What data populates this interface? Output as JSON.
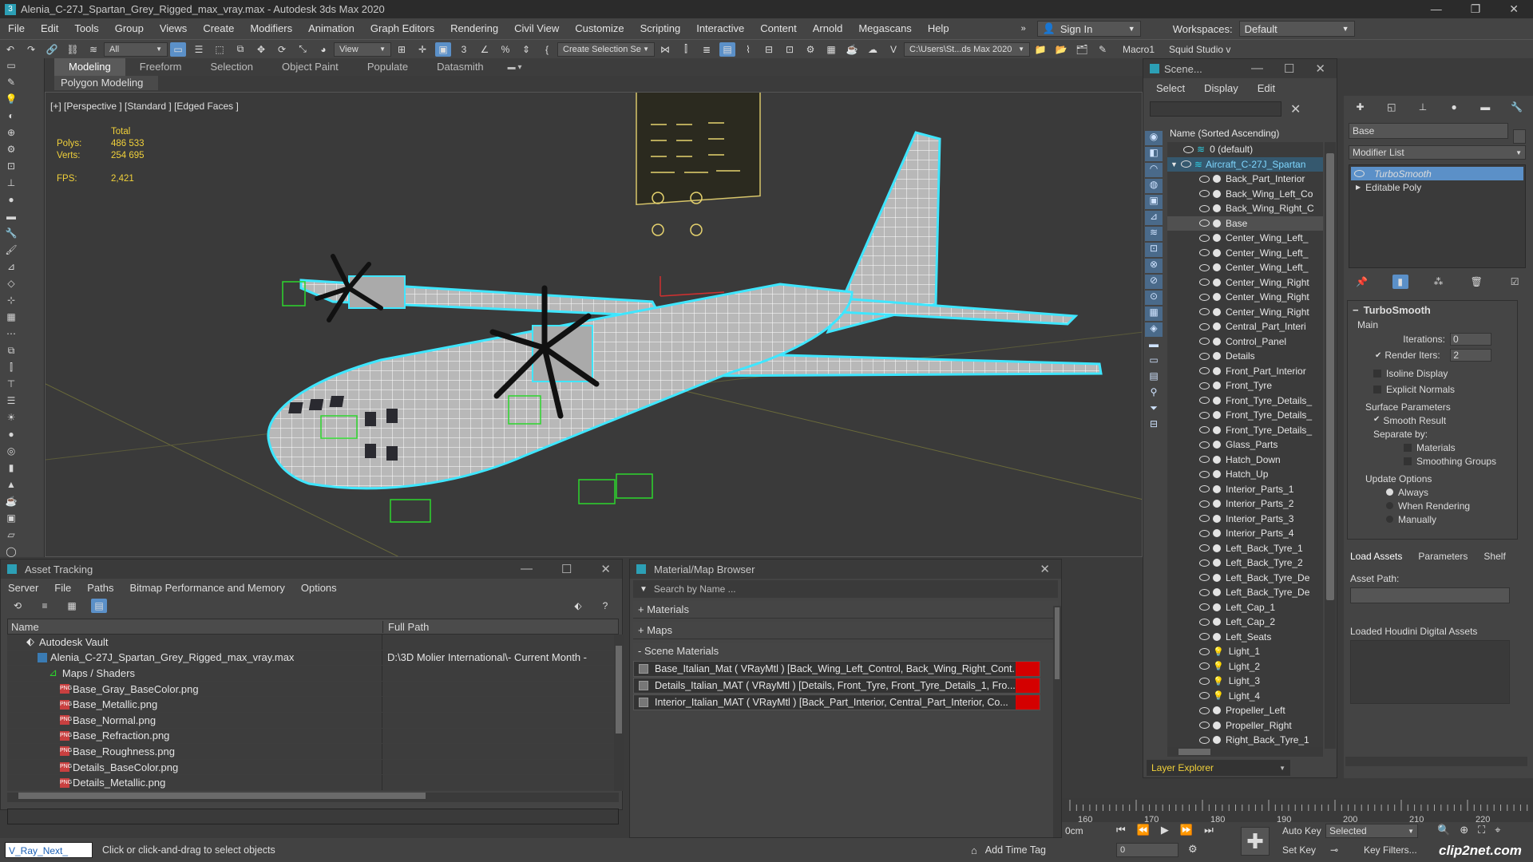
{
  "window": {
    "title": "Alenia_C-27J_Spartan_Grey_Rigged_max_vray.max - Autodesk 3ds Max 2020"
  },
  "menu": [
    "File",
    "Edit",
    "Tools",
    "Group",
    "Views",
    "Create",
    "Modifiers",
    "Animation",
    "Graph Editors",
    "Rendering",
    "Civil View",
    "Customize",
    "Scripting",
    "Interactive",
    "Content",
    "Arnold",
    "Megascans",
    "Help"
  ],
  "signin": "Sign In",
  "workspaces": {
    "label": "Workspaces:",
    "value": "Default"
  },
  "toolbar": {
    "filter": "All",
    "refcoord": "View",
    "selset": "Create Selection Se",
    "path": "C:\\Users\\St...ds Max 2020",
    "macro": "Macro1",
    "squid": "Squid Studio v"
  },
  "ribbon": {
    "tabs": [
      "Modeling",
      "Freeform",
      "Selection",
      "Object Paint",
      "Populate",
      "Datasmith"
    ],
    "sub": "Polygon Modeling"
  },
  "viewport": {
    "label": "[+] [Perspective ] [Standard ] [Edged Faces ]",
    "stats": {
      "total": "Total",
      "polys_label": "Polys:",
      "polys": "486 533",
      "verts_label": "Verts:",
      "verts": "254 695",
      "fps_label": "FPS:",
      "fps": "2,421"
    }
  },
  "scene": {
    "title": "Scene...",
    "menu": [
      "Select",
      "Display",
      "Edit"
    ],
    "header": "Name (Sorted Ascending)",
    "root": "0 (default)",
    "model": "Aircraft_C-27J_Spartan",
    "items": [
      "Back_Part_Interior",
      "Back_Wing_Left_Co",
      "Back_Wing_Right_C",
      "Base",
      "Center_Wing_Left_",
      "Center_Wing_Left_",
      "Center_Wing_Left_",
      "Center_Wing_Right",
      "Center_Wing_Right",
      "Center_Wing_Right",
      "Central_Part_Interi",
      "Control_Panel",
      "Details",
      "Front_Part_Interior",
      "Front_Tyre",
      "Front_Tyre_Details_",
      "Front_Tyre_Details_",
      "Front_Tyre_Details_",
      "Glass_Parts",
      "Hatch_Down",
      "Hatch_Up",
      "Interior_Parts_1",
      "Interior_Parts_2",
      "Interior_Parts_3",
      "Interior_Parts_4",
      "Left_Back_Tyre_1",
      "Left_Back_Tyre_2",
      "Left_Back_Tyre_De",
      "Left_Back_Tyre_De",
      "Left_Cap_1",
      "Left_Cap_2",
      "Left_Seats",
      "Light_1",
      "Light_2",
      "Light_3",
      "Light_4",
      "Propeller_Left",
      "Propeller_Right",
      "Right_Back_Tyre_1"
    ],
    "footer": "Layer Explorer"
  },
  "command": {
    "object_name": "Base",
    "modifier_list": "Modifier List",
    "stack": [
      "TurboSmooth",
      "Editable Poly"
    ],
    "turbosmooth": {
      "title": "TurboSmooth",
      "main": "Main",
      "iterations_label": "Iterations:",
      "iterations": "0",
      "render_iters_label": "Render Iters:",
      "render_iters": "2",
      "isoline": "Isoline Display",
      "explicit": "Explicit Normals",
      "surface": "Surface Parameters",
      "smooth": "Smooth Result",
      "separate": "Separate by:",
      "materials": "Materials",
      "smoothing": "Smoothing Groups",
      "update": "Update Options",
      "always": "Always",
      "when_rendering": "When Rendering",
      "manually": "Manually"
    },
    "tabs": [
      "Load Assets",
      "Parameters",
      "Shelf"
    ],
    "asset_path": "Asset Path:",
    "houdini": "Loaded Houdini Digital Assets"
  },
  "assets": {
    "title": "Asset Tracking",
    "menu": [
      "Server",
      "File",
      "Paths",
      "Bitmap Performance and Memory",
      "Options"
    ],
    "cols": [
      "Name",
      "Full Path"
    ],
    "rows": [
      {
        "name": "Autodesk Vault",
        "path": "",
        "indent": 1
      },
      {
        "name": "Alenia_C-27J_Spartan_Grey_Rigged_max_vray.max",
        "path": "D:\\3D Molier International\\- Current Month -",
        "indent": 2
      },
      {
        "name": "Maps / Shaders",
        "path": "",
        "indent": 3
      },
      {
        "name": "Base_Gray_BaseColor.png",
        "path": "",
        "indent": 4
      },
      {
        "name": "Base_Metallic.png",
        "path": "",
        "indent": 4
      },
      {
        "name": "Base_Normal.png",
        "path": "",
        "indent": 4
      },
      {
        "name": "Base_Refraction.png",
        "path": "",
        "indent": 4
      },
      {
        "name": "Base_Roughness.png",
        "path": "",
        "indent": 4
      },
      {
        "name": "Details_BaseColor.png",
        "path": "",
        "indent": 4
      },
      {
        "name": "Details_Metallic.png",
        "path": "",
        "indent": 4
      }
    ]
  },
  "materials": {
    "title": "Material/Map Browser",
    "search": "Search by Name ...",
    "groups": [
      "+ Materials",
      "+ Maps",
      "- Scene Materials"
    ],
    "items": [
      "Base_Italian_Mat  ( VRayMtl )  [Back_Wing_Left_Control, Back_Wing_Right_Cont...",
      "Details_Italian_MAT  ( VRayMtl )  [Details, Front_Tyre, Front_Tyre_Details_1, Fro...",
      "Interior_Italian_MAT  ( VRayMtl )  [Back_Part_Interior, Central_Part_Interior, Co..."
    ]
  },
  "timeline": {
    "ticks": [
      "160",
      "170",
      "180",
      "190",
      "200",
      "210",
      "220"
    ],
    "unit": "0cm"
  },
  "status": {
    "script": "V_Ray_Next_",
    "prompt": "Click or click-and-drag to select objects",
    "addtime": "Add Time Tag",
    "frame": "0",
    "autokey": "Auto Key",
    "setkey": "Set Key",
    "selected": "Selected",
    "keyfilters": "Key Filters...",
    "watermark": "clip2net.com"
  }
}
